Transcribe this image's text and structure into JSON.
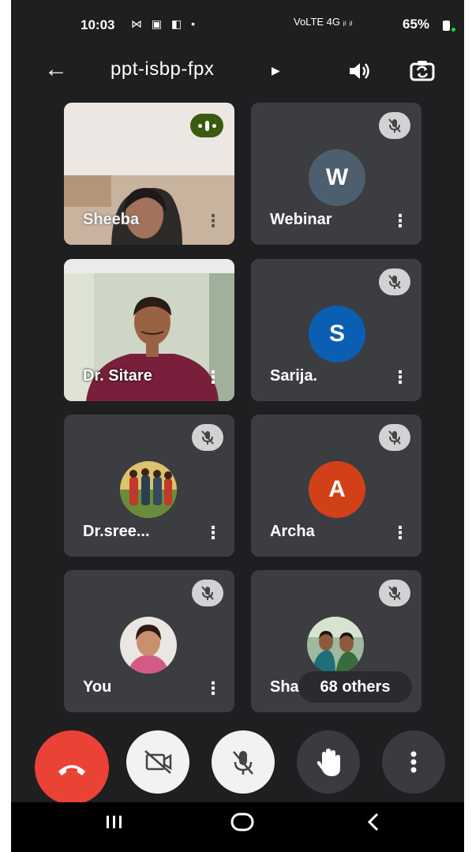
{
  "status_bar": {
    "time": "10:03",
    "left_icons": "⋈ ▣ ◧ •",
    "right_icons": "VoLTE 4G ᵢₗ ᵢₗ",
    "battery": "65%"
  },
  "header": {
    "meeting_code": "ppt-isbp-fpx"
  },
  "participants": [
    {
      "name": "Sheeba",
      "type": "video",
      "speaking": true
    },
    {
      "name": "Webinar",
      "type": "letter",
      "initial": "W",
      "color": "#4d5f6e",
      "muted": true
    },
    {
      "name": "Dr. Sitare",
      "type": "video",
      "muted": false
    },
    {
      "name": "Sarija.",
      "type": "letter",
      "initial": "S",
      "color": "#0b5fb3",
      "muted": true
    },
    {
      "name": "Dr.sree...",
      "type": "photo",
      "muted": true
    },
    {
      "name": "Archa",
      "type": "letter",
      "initial": "A",
      "color": "#d2401a",
      "muted": true
    },
    {
      "name": "You",
      "type": "photo",
      "muted": true
    },
    {
      "name": "Sha",
      "type": "photo",
      "muted": true
    }
  ],
  "others_badge": "68 others",
  "more_glyph": "⋮",
  "controls": [
    "end-call",
    "camera-off",
    "mic-off",
    "raise-hand",
    "more-options"
  ],
  "colors": {
    "end_call": "#ea4335",
    "speaking": "#3b5a11",
    "background": "#1f1f21",
    "tile": "#3b3d40"
  }
}
